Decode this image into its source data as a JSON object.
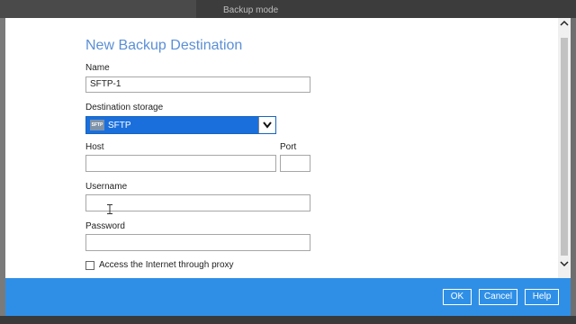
{
  "background": {
    "mode_label": "Backup mode"
  },
  "dialog": {
    "title": "New Backup Destination",
    "name": {
      "label": "Name",
      "value": "SFTP-1"
    },
    "destination_storage": {
      "label": "Destination storage",
      "selected": "SFTP",
      "icon_text": "SFTP"
    },
    "host": {
      "label": "Host",
      "value": ""
    },
    "port": {
      "label": "Port",
      "value": ""
    },
    "username": {
      "label": "Username",
      "value": ""
    },
    "password": {
      "label": "Password",
      "value": ""
    },
    "proxy": {
      "label": "Access the Internet through proxy",
      "checked": false
    }
  },
  "footer": {
    "ok_label": "OK",
    "cancel_label": "Cancel",
    "help_label": "Help"
  },
  "colors": {
    "title": "#5b8fd6",
    "select_bg": "#1b6fdc",
    "footer_bg": "#2f8fe6"
  }
}
